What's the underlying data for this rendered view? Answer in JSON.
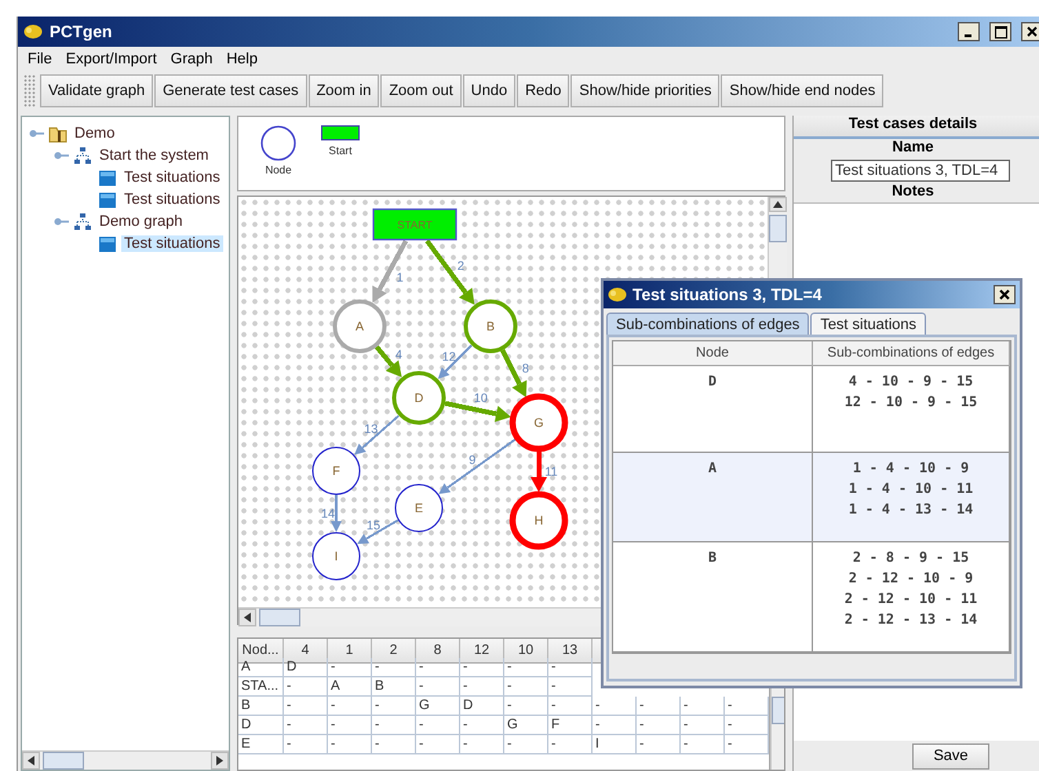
{
  "window": {
    "title": "PCTgen"
  },
  "menu": [
    "File",
    "Export/Import",
    "Graph",
    "Help"
  ],
  "toolbar": [
    "Validate graph",
    "Generate test cases",
    "Zoom in",
    "Zoom out",
    "Undo",
    "Redo",
    "Show/hide priorities",
    "Show/hide end nodes"
  ],
  "tree": [
    {
      "label": "Demo",
      "kind": "folder",
      "selected": false,
      "children": [
        {
          "label": "Start the system",
          "kind": "graph",
          "selected": false,
          "children": [
            {
              "label": "Test situations",
              "kind": "cases",
              "selected": false
            },
            {
              "label": "Test situations",
              "kind": "cases",
              "selected": false
            }
          ]
        },
        {
          "label": "Demo graph",
          "kind": "graph",
          "selected": false,
          "children": [
            {
              "label": "Test situations",
              "kind": "cases",
              "selected": true
            }
          ]
        }
      ]
    }
  ],
  "palette": [
    {
      "label": "Node",
      "kind": "node"
    },
    {
      "label": "Start",
      "kind": "start"
    }
  ],
  "graph": {
    "nodes": [
      {
        "label": "START",
        "kind": "start",
        "color": "#00ee00",
        "bold": false
      },
      {
        "label": "A",
        "kind": "node",
        "color": "#aaaaaa",
        "bold": true
      },
      {
        "label": "B",
        "kind": "node",
        "color": "#66aa00",
        "bold": true
      },
      {
        "label": "D",
        "kind": "node",
        "color": "#66aa00",
        "bold": true
      },
      {
        "label": "G",
        "kind": "node",
        "color": "#ff0000",
        "bold": true
      },
      {
        "label": "F",
        "kind": "node",
        "color": "#2222cc",
        "bold": false
      },
      {
        "label": "E",
        "kind": "node",
        "color": "#2222cc",
        "bold": false
      },
      {
        "label": "H",
        "kind": "node",
        "color": "#ff0000",
        "bold": true
      },
      {
        "label": "I",
        "kind": "node",
        "color": "#2222cc",
        "bold": false
      }
    ],
    "edges": [
      {
        "label": "1",
        "color": "#aaaaaa",
        "bold": true
      },
      {
        "label": "2",
        "color": "#66aa00",
        "bold": true
      },
      {
        "label": "4",
        "color": "#66aa00",
        "bold": true
      },
      {
        "label": "12",
        "color": "#7799cc",
        "bold": false
      },
      {
        "label": "8",
        "color": "#66aa00",
        "bold": true
      },
      {
        "label": "10",
        "color": "#66aa00",
        "bold": true
      },
      {
        "label": "13",
        "color": "#7799cc",
        "bold": false
      },
      {
        "label": "9",
        "color": "#7799cc",
        "bold": false
      },
      {
        "label": "11",
        "color": "#ff0000",
        "bold": true
      },
      {
        "label": "14",
        "color": "#7799cc",
        "bold": false
      },
      {
        "label": "15",
        "color": "#7799cc",
        "bold": false
      }
    ]
  },
  "matrix": {
    "columns": [
      "Nod...",
      "4",
      "1",
      "2",
      "8",
      "12",
      "10",
      "13"
    ],
    "rows": [
      {
        "label": "A",
        "cells": [
          "D",
          "-",
          "-",
          "-",
          "-",
          "-",
          "-"
        ]
      },
      {
        "label": "STA...",
        "cells": [
          "-",
          "A",
          "B",
          "-",
          "-",
          "-",
          "-"
        ]
      },
      {
        "label": "B",
        "cells": [
          "-",
          "-",
          "-",
          "G",
          "D",
          "-",
          "-",
          "-",
          "-",
          "-",
          "-"
        ]
      },
      {
        "label": "D",
        "cells": [
          "-",
          "-",
          "-",
          "-",
          "-",
          "G",
          "F",
          "-",
          "-",
          "-",
          "-"
        ]
      },
      {
        "label": "E",
        "cells": [
          "-",
          "-",
          "-",
          "-",
          "-",
          "-",
          "-",
          "I",
          "-",
          "-",
          "-"
        ]
      }
    ]
  },
  "details": {
    "title": "Test cases details",
    "name_label": "Name",
    "name_value": "Test situations 3, TDL=4",
    "notes_label": "Notes",
    "save": "Save"
  },
  "dialog": {
    "title": "Test situations 3, TDL=4",
    "tabs": [
      {
        "label": "Sub-combinations of edges",
        "selected": true
      },
      {
        "label": "Test situations",
        "selected": false
      }
    ],
    "columns": [
      "Node",
      "Sub-combinations of edges"
    ],
    "rows": [
      {
        "node": "D",
        "combinations": [
          "4 - 10 - 9 - 15",
          "12 - 10 - 9 - 15"
        ],
        "selected": false
      },
      {
        "node": "A",
        "combinations": [
          "1 - 4 - 10 - 9",
          "1 - 4 - 10 - 11",
          "1 - 4 - 13 - 14"
        ],
        "selected": true
      },
      {
        "node": "B",
        "combinations": [
          "2 - 8 - 9 - 15",
          "2 - 12 - 10 - 9",
          "2 - 12 - 10 - 11",
          "2 - 12 - 13 - 14"
        ],
        "selected": false
      }
    ]
  }
}
